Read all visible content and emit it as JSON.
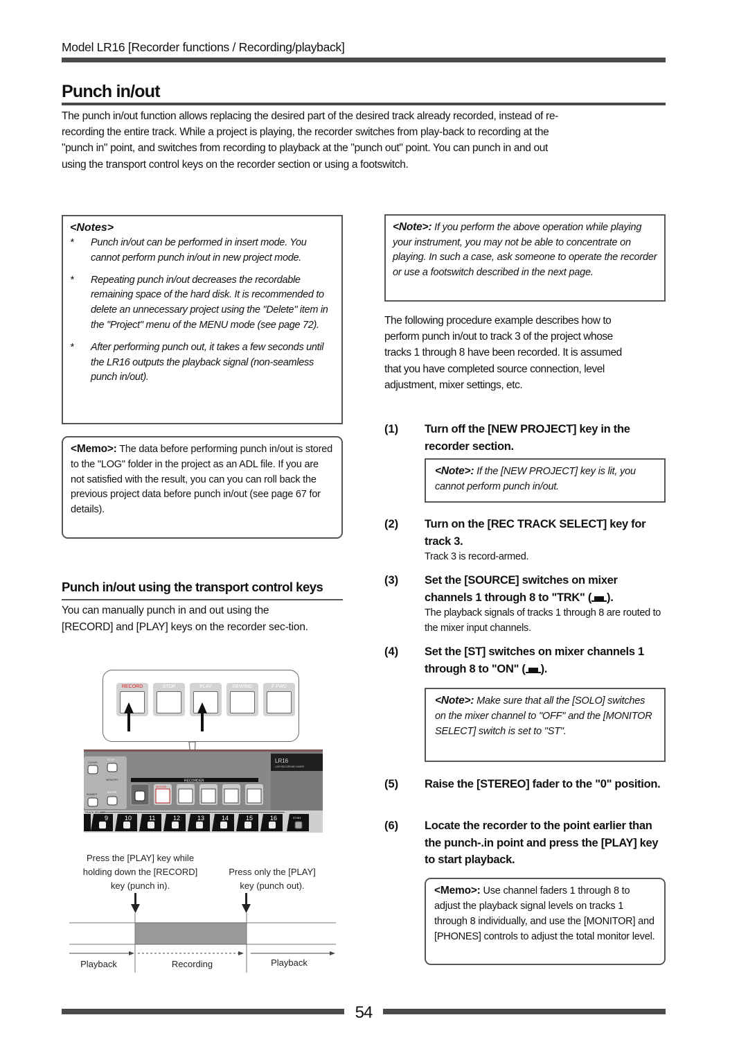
{
  "header": {
    "text": "Model LR16 [Recorder functions / Recording/playback]"
  },
  "title": "Punch in/out",
  "intro": "The punch in/out function allows replacing the desired part of the desired track already recorded, instead of re-recording the entire track. While a project is playing, the recorder switches from play-back to recording at the \"punch in\" point, and switches from recording to playback at the \"punch out\" point. You can punch in and out using the transport control keys on the recorder section or using a footswitch.",
  "notes": {
    "title": "<Notes>",
    "items": [
      {
        "bullet": "*",
        "text": "Punch in/out can be performed in insert mode. You cannot perform punch in/out in new project mode."
      },
      {
        "bullet": "*",
        "text": "Repeating punch in/out decreases the recordable remaining space of the hard disk. It is recommended to delete an unnecessary project using the \"Delete\" item in the \"Project\" menu of the MENU mode (see page 72)."
      },
      {
        "bullet": "*",
        "text": "After performing punch out, it takes a few seconds until the LR16 outputs the playback signal (non-seamless punch in/out)."
      }
    ]
  },
  "memo1": {
    "label": "<Memo>:",
    "text": " The data before performing punch in/out is stored to the \"LOG\" folder in the project as an ADL file. If you are not satisfied with the result, you can you can roll back the previous project data before punch in/out (see page 67 for details)."
  },
  "subsection": {
    "title": "Punch in/out using the transport control keys",
    "body": "You can manually punch in and out using the [RECORD] and [PLAY] keys on the recorder sec-tion."
  },
  "figure": {
    "callout_keys": [
      "RECORD",
      "STOP",
      "PLAY",
      "REWIND",
      "F FWD"
    ],
    "panel": {
      "left_keys": [
        "CLEAR",
        "STOP",
        "MEMORY",
        "NUMBER",
        "ENTER"
      ],
      "recorder_label": "RECORDER",
      "recorder_keys": [
        "NEW PROJECT",
        "RECORD",
        "STOP",
        "PLAY",
        "REWIND",
        "F FWD"
      ],
      "brand": "LR16",
      "brand_sub": "LIVE RECORDING MIXER",
      "track_select_label": "TRACK SELECT",
      "tracks": [
        "9",
        "10",
        "11",
        "12",
        "13",
        "14",
        "15",
        "16"
      ],
      "st_mix": "ST MIX"
    },
    "timeline": {
      "punch_in_caption": [
        "Press the [PLAY] key while",
        "holding down the [RECORD]",
        "key (punch in)."
      ],
      "punch_out_caption": [
        "Press only the [PLAY]",
        "key (punch out)."
      ],
      "segments": [
        "Playback",
        "Recording",
        "Playback"
      ]
    }
  },
  "right_note": {
    "label": "<Note>:",
    "text": " If you perform the above operation while playing your instrument, you may not be able to concentrate on playing. In such a case, ask someone to operate the recorder or use a footswitch described in the next page."
  },
  "right_para": "The following procedure example describes how to perform punch in/out to track 3 of the project whose tracks 1 through 8 have been recorded. It is assumed that you have completed source connection, level adjustment, mixer settings, etc.",
  "steps": [
    {
      "num": "(1)",
      "title": "Turn off the [NEW PROJECT] key in the recorder section."
    },
    {
      "num": "(2)",
      "title": "Turn on the [REC TRACK SELECT] key for track 3.",
      "desc": "Track 3 is record-armed."
    },
    {
      "num": "(3)",
      "title_pre": "Set the [SOURCE] switches on mixer channels 1 through 8 to \"TRK\" (",
      "title_post": ").",
      "desc": "The playback signals of tracks 1 through 8 are routed to the mixer input channels."
    },
    {
      "num": "(4)",
      "title_pre": "Set the [ST] switches on mixer channels 1 through 8 to \"ON\" (",
      "title_post": ")."
    },
    {
      "num": "(5)",
      "title": "Raise the [STEREO] fader to the \"0\" position."
    },
    {
      "num": "(6)",
      "title": "Locate the recorder to the point earlier than the punch-.in point and press the [PLAY] key to start playback."
    }
  ],
  "step_notes": {
    "n1": {
      "label": "<Note>:",
      "text": " If the [NEW PROJECT] key is lit, you cannot perform punch in/out."
    },
    "n4": {
      "label": "<Note>:",
      "text": " Make sure that all the [SOLO] switches on the mixer channel to \"OFF\" and the [MONITOR SELECT] switch is set to \"ST\"."
    },
    "m6": {
      "label": "<Memo>:",
      "text": " Use channel faders 1 through 8 to adjust the playback signal levels on tracks 1 through 8 individually, and use the [MONITOR] and [PHONES] controls to adjust the total monitor level."
    }
  },
  "footer": {
    "page": "54"
  }
}
